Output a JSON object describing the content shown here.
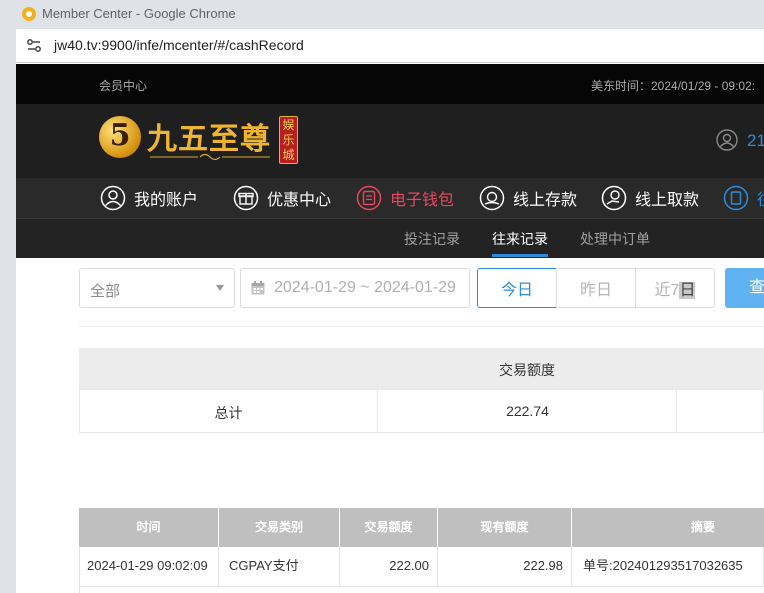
{
  "browser": {
    "window_title": "Member Center - Google Chrome",
    "url": "jw40.tv:9900/infe/mcenter/#/cashRecord"
  },
  "topbar": {
    "member_center": "会员中心",
    "us_time": "美东时间：2024/01/29 - 09:02:"
  },
  "header": {
    "logo_number": "5",
    "logo_text": "九五至尊",
    "logo_badge": [
      "娱",
      "乐",
      "城"
    ],
    "user_balance": "21"
  },
  "mainnav": {
    "items": [
      {
        "label": "我的账户",
        "icon": "user-icon"
      },
      {
        "label": "优惠中心",
        "icon": "gift-icon"
      },
      {
        "label": "电子钱包",
        "icon": "wallet-icon"
      },
      {
        "label": "线上存款",
        "icon": "deposit-icon"
      },
      {
        "label": "线上取款",
        "icon": "withdraw-icon"
      },
      {
        "label": "往",
        "icon": "record-icon"
      }
    ],
    "active_index": 2,
    "active_color": "#e8475e"
  },
  "subnav": {
    "items": [
      "投注记录",
      "往来记录",
      "处理中订单"
    ],
    "active_index": 1,
    "accent": "#2f8cdc"
  },
  "filters": {
    "type_value": "全部",
    "date_range": "2024-01-29 ~ 2024-01-29",
    "quick_buttons": [
      "今日",
      "昨日",
      "近7日"
    ],
    "quick_active_index": 0,
    "query_label": "查"
  },
  "summary": {
    "header": "交易额度",
    "total_label": "总计",
    "total_value": "222.74"
  },
  "records": {
    "columns": [
      "时间",
      "交易类别",
      "交易额度",
      "现有额度",
      "摘要"
    ],
    "rows": [
      [
        "2024-01-29 09:02:09",
        "CGPAY支付",
        "222.00",
        "222.98",
        "单号:202401293517032635"
      ]
    ]
  }
}
